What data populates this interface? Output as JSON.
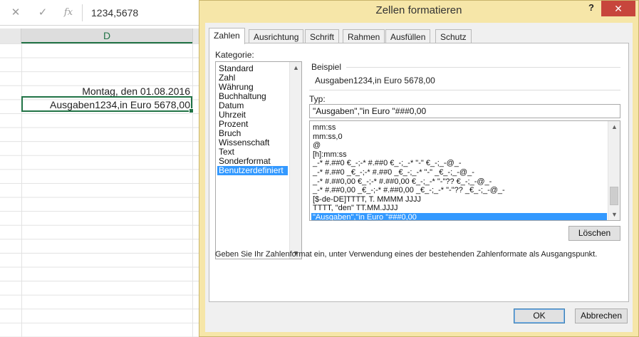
{
  "formula_bar": {
    "cancel_icon": "close-icon",
    "enter_icon": "check-icon",
    "function_label": "fx",
    "value": "1234,5678"
  },
  "sheet": {
    "column_header": "D",
    "cells": [
      {
        "text": "Montag, den 01.08.2016"
      },
      {
        "text": "Ausgaben1234,in Euro 5678,00"
      }
    ]
  },
  "dialog": {
    "title": "Zellen formatieren",
    "help_label": "?",
    "close_label": "✕",
    "tabs": [
      {
        "label": "Zahlen"
      },
      {
        "label": "Ausrichtung"
      },
      {
        "label": "Schrift"
      },
      {
        "label": "Rahmen"
      },
      {
        "label": "Ausfüllen"
      },
      {
        "label": "Schutz"
      }
    ],
    "category_label": "Kategorie:",
    "categories": [
      "Standard",
      "Zahl",
      "Währung",
      "Buchhaltung",
      "Datum",
      "Uhrzeit",
      "Prozent",
      "Bruch",
      "Wissenschaft",
      "Text",
      "Sonderformat",
      "Benutzerdefiniert"
    ],
    "selected_category": "Benutzerdefiniert",
    "sample_label": "Beispiel",
    "sample_value": "Ausgaben1234,in Euro 5678,00",
    "type_label": "Typ:",
    "type_value": "\"Ausgaben\",\"in Euro \"###0,00",
    "formats": [
      "mm:ss",
      "mm:ss,0",
      "@",
      "[h]:mm:ss",
      "_-* #.##0 €_-;-* #.##0 €_-;_-* \"-\" €_-;_-@_-",
      "_-* #.##0 _€_-;-* #.##0 _€_-;_-* \"-\" _€_-;_-@_-",
      "_-* #.##0,00 €_-;-* #.##0,00 €_-;_-* \"-\"?? €_-;_-@_-",
      "_-* #.##0,00 _€_-;-* #.##0,00 _€_-;_-* \"-\"?? _€_-;_-@_-",
      "[$-de-DE]TTTT, T. MMMM JJJJ",
      "TTTT, \"den\" TT.MM.JJJJ",
      "\"Ausgaben\",\"in Euro \"###0,00"
    ],
    "selected_format": "\"Ausgaben\",\"in Euro \"###0,00",
    "delete_label": "Löschen",
    "hint": "Geben Sie Ihr Zahlenformat ein, unter Verwendung eines der bestehenden Zahlenformate als Ausgangspunkt.",
    "ok_label": "OK",
    "cancel_label": "Abbrechen"
  },
  "colors": {
    "dialog_frame": "#f6e6a8",
    "close_button": "#c7463c",
    "selection": "#3399ff",
    "excel_green": "#217346"
  }
}
